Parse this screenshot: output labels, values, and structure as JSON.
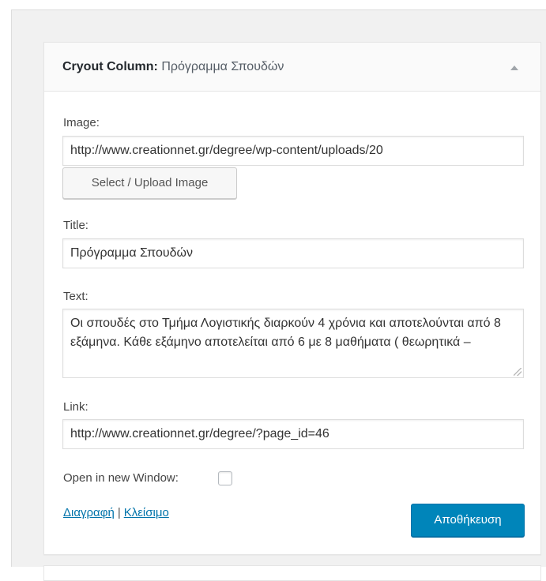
{
  "widget": {
    "name": "Cryout Column",
    "separator": ":",
    "subtitle": "Πρόγραμμα Σπουδών",
    "toggle_icon": "arrow-up-icon"
  },
  "fields": {
    "image": {
      "label": "Image:",
      "value": "http://www.creationnet.gr/degree/wp-content/uploads/20"
    },
    "upload_button_label": "Select / Upload Image",
    "title": {
      "label": "Title:",
      "value": "Πρόγραμμα Σπουδών"
    },
    "text": {
      "label": "Text:",
      "value": "Οι σπουδές στο Τμήμα Λογιστικής διαρκούν 4 χρόνια και αποτελούνται από 8 εξάμηνα. Κάθε εξάμηνο αποτελείται από 6 με 8 μαθήματα ( θεωρητικά –"
    },
    "link": {
      "label": "Link:",
      "value": "http://www.creationnet.gr/degree/?page_id=46"
    },
    "new_window": {
      "label": "Open in new Window:",
      "checked": false
    }
  },
  "actions": {
    "delete_label": "Διαγραφή",
    "separator": "|",
    "close_label": "Κλείσιμο",
    "save_label": "Αποθήκευση"
  },
  "colors": {
    "accent": "#0085ba",
    "link": "#0073aa",
    "background": "#f1f1f1"
  }
}
